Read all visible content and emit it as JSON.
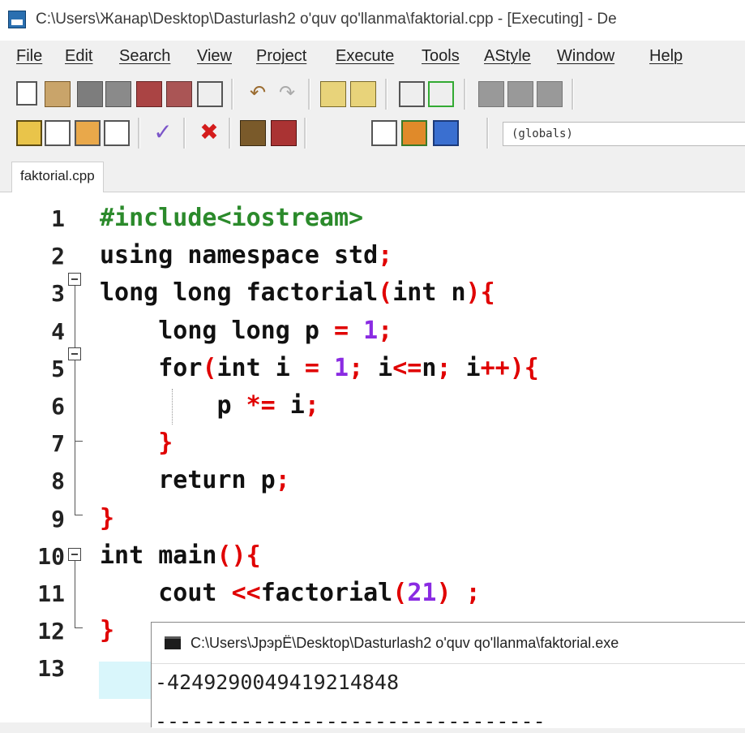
{
  "window": {
    "title": "C:\\Users\\Жанар\\Desktop\\Dasturlash2 o'quv qo'llanma\\faktorial.cpp - [Executing] - De"
  },
  "menu": [
    {
      "label": "File"
    },
    {
      "label": "Edit"
    },
    {
      "label": "Search"
    },
    {
      "label": "View"
    },
    {
      "label": "Project"
    },
    {
      "label": "Execute"
    },
    {
      "label": "Tools"
    },
    {
      "label": "AStyle"
    },
    {
      "label": "Window"
    },
    {
      "label": "Help"
    }
  ],
  "toolbar": {
    "scope_value": "(globals)"
  },
  "tabs": [
    {
      "label": "faktorial.cpp"
    }
  ],
  "editor": {
    "line_numbers": [
      "1",
      "2",
      "3",
      "4",
      "5",
      "6",
      "7",
      "8",
      "9",
      "10",
      "11",
      "12",
      "13"
    ],
    "lines": [
      [
        {
          "t": "#include<iostream>",
          "c": "pp"
        }
      ],
      [
        {
          "t": "using namespace std",
          "c": "kw"
        },
        {
          "t": ";",
          "c": "sym"
        }
      ],
      [
        {
          "t": "long long factorial",
          "c": "kw"
        },
        {
          "t": "(",
          "c": "sym"
        },
        {
          "t": "int n",
          "c": "kw"
        },
        {
          "t": "){",
          "c": "sym"
        }
      ],
      [
        {
          "t": "    long long p ",
          "c": "kw"
        },
        {
          "t": "=",
          "c": "sym"
        },
        {
          "t": " ",
          "c": "kw"
        },
        {
          "t": "1",
          "c": "num"
        },
        {
          "t": ";",
          "c": "sym"
        }
      ],
      [
        {
          "t": "    for",
          "c": "kw"
        },
        {
          "t": "(",
          "c": "sym"
        },
        {
          "t": "int i ",
          "c": "kw"
        },
        {
          "t": "=",
          "c": "sym"
        },
        {
          "t": " ",
          "c": "kw"
        },
        {
          "t": "1",
          "c": "num"
        },
        {
          "t": ";",
          "c": "sym"
        },
        {
          "t": " i",
          "c": "kw"
        },
        {
          "t": "<=",
          "c": "sym"
        },
        {
          "t": "n",
          "c": "kw"
        },
        {
          "t": ";",
          "c": "sym"
        },
        {
          "t": " i",
          "c": "kw"
        },
        {
          "t": "++){",
          "c": "sym"
        }
      ],
      [
        {
          "t": "        p ",
          "c": "kw"
        },
        {
          "t": "*=",
          "c": "sym"
        },
        {
          "t": " i",
          "c": "kw"
        },
        {
          "t": ";",
          "c": "sym"
        }
      ],
      [
        {
          "t": "    }",
          "c": "sym"
        }
      ],
      [
        {
          "t": "    return p",
          "c": "kw"
        },
        {
          "t": ";",
          "c": "sym"
        }
      ],
      [
        {
          "t": "}",
          "c": "sym"
        }
      ],
      [
        {
          "t": "int main",
          "c": "kw"
        },
        {
          "t": "(){",
          "c": "sym"
        }
      ],
      [
        {
          "t": "    cout ",
          "c": "kw"
        },
        {
          "t": "<<",
          "c": "sym"
        },
        {
          "t": "factorial",
          "c": "kw"
        },
        {
          "t": "(",
          "c": "sym"
        },
        {
          "t": "21",
          "c": "num"
        },
        {
          "t": ")",
          "c": "sym"
        },
        {
          "t": " ",
          "c": "kw"
        },
        {
          "t": ";",
          "c": "sym"
        }
      ],
      [
        {
          "t": "}",
          "c": "sym"
        }
      ],
      []
    ]
  },
  "console": {
    "title": "C:\\Users\\ЈрэрЁ\\Desktop\\Dasturlash2 o'quv qo'llanma\\faktorial.exe",
    "output": "-4249290049419214848",
    "separator": "--------------------------------"
  },
  "colors": {
    "preprocessor": "#2b8a2b",
    "symbol": "#e00000",
    "number": "#8a2be2",
    "current_line": "#d9f6fb"
  }
}
